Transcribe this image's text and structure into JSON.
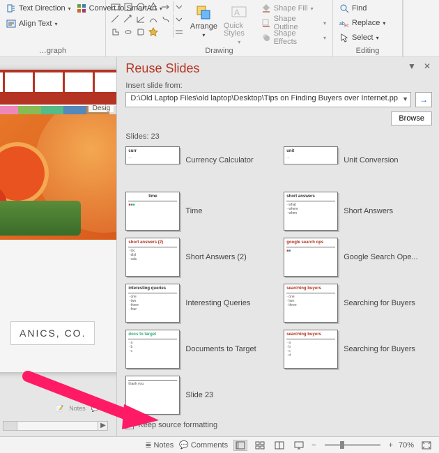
{
  "ribbon": {
    "paragraph": {
      "label": "…graph",
      "text_direction": "Text Direction",
      "align_text": "Align Text",
      "convert_smartart": "Convert to SmartArt"
    },
    "drawing": {
      "label": "Drawing",
      "arrange": "Arrange",
      "quick_styles": "Quick Styles",
      "shape_fill": "Shape Fill",
      "shape_outline": "Shape Outline",
      "shape_effects": "Shape Effects"
    },
    "editing": {
      "label": "Editing",
      "find": "Find",
      "replace": "Replace",
      "select": "Select"
    }
  },
  "slide_preview": {
    "design_label": "Desig",
    "text_block": "ANICS, CO.",
    "mini_notes": "Notes",
    "mini_comments": "Comments"
  },
  "pane": {
    "title": "Reuse Slides",
    "insert_label": "Insert slide from:",
    "file_path": "D:\\Old Laptop Files\\old laptop\\Desktop\\Tips on Finding Buyers over Internet.pp",
    "browse": "Browse",
    "count": "Slides: 23",
    "keep_source": "Keep source formatting",
    "slides": [
      {
        "name": "Currency Calculator"
      },
      {
        "name": "Unit Conversion"
      },
      {
        "name": "Time"
      },
      {
        "name": "Short Answers"
      },
      {
        "name": "Short Answers (2)"
      },
      {
        "name": "Google Search Ope..."
      },
      {
        "name": "Interesting Queries"
      },
      {
        "name": "Searching for Buyers"
      },
      {
        "name": "Documents to Target"
      },
      {
        "name": "Searching for Buyers"
      },
      {
        "name": "Slide 23"
      }
    ]
  },
  "status": {
    "notes": "Notes",
    "comments": "Comments",
    "zoom": "70%"
  },
  "colors": {
    "accent": "#b43322"
  },
  "chart_data": null
}
